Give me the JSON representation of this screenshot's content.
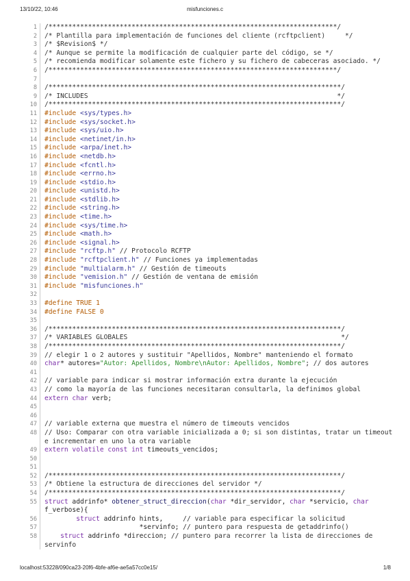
{
  "header": {
    "datetime": "13/10/22, 10:46",
    "title": "misfunciones.c"
  },
  "footer": {
    "url": "localhost:53228/090ca23-20f6-4bfe-af6e-ae5a57cc0e15/",
    "page": "1/8"
  },
  "colors": {
    "comment": "#333333",
    "preprocessor": "#b35a00",
    "include_path": "#3a3a9a",
    "keyword": "#7a2ea8",
    "string": "#2e8b2e",
    "line_number": "#888888"
  },
  "lines": [
    {
      "n": "1",
      "t": [
        [
          "comment",
          "/*************************************************************************/"
        ]
      ]
    },
    {
      "n": "2",
      "t": [
        [
          "comment",
          "/* Plantilla para implementación de funciones del cliente (rcftpclient)     */"
        ]
      ]
    },
    {
      "n": "3",
      "t": [
        [
          "comment",
          "/* $Revision$ */"
        ]
      ]
    },
    {
      "n": "4",
      "t": [
        [
          "comment",
          "/* Aunque se permite la modificación de cualquier parte del código, se */"
        ]
      ]
    },
    {
      "n": "5",
      "t": [
        [
          "comment",
          "/* recomienda modificar solamente este fichero y su fichero de cabeceras asociado. */"
        ]
      ]
    },
    {
      "n": "6",
      "t": [
        [
          "comment",
          "/*************************************************************************/"
        ]
      ]
    },
    {
      "n": "7",
      "t": []
    },
    {
      "n": "8",
      "t": [
        [
          "comment",
          "/**************************************************************************/"
        ]
      ]
    },
    {
      "n": "9",
      "t": [
        [
          "comment",
          "/* INCLUDES                                                               */"
        ]
      ]
    },
    {
      "n": "10",
      "t": [
        [
          "comment",
          "/**************************************************************************/"
        ]
      ]
    },
    {
      "n": "11",
      "t": [
        [
          "pre",
          "#include "
        ],
        [
          "inc",
          "<sys/types.h>"
        ]
      ]
    },
    {
      "n": "12",
      "t": [
        [
          "pre",
          "#include "
        ],
        [
          "inc",
          "<sys/socket.h>"
        ]
      ]
    },
    {
      "n": "13",
      "t": [
        [
          "pre",
          "#include "
        ],
        [
          "inc",
          "<sys/uio.h>"
        ]
      ]
    },
    {
      "n": "14",
      "t": [
        [
          "pre",
          "#include "
        ],
        [
          "inc",
          "<netinet/in.h>"
        ]
      ]
    },
    {
      "n": "15",
      "t": [
        [
          "pre",
          "#include "
        ],
        [
          "inc",
          "<arpa/inet.h>"
        ]
      ]
    },
    {
      "n": "16",
      "t": [
        [
          "pre",
          "#include "
        ],
        [
          "inc",
          "<netdb.h>"
        ]
      ]
    },
    {
      "n": "17",
      "t": [
        [
          "pre",
          "#include "
        ],
        [
          "inc",
          "<fcntl.h>"
        ]
      ]
    },
    {
      "n": "18",
      "t": [
        [
          "pre",
          "#include "
        ],
        [
          "inc",
          "<errno.h>"
        ]
      ]
    },
    {
      "n": "19",
      "t": [
        [
          "pre",
          "#include "
        ],
        [
          "inc",
          "<stdio.h>"
        ]
      ]
    },
    {
      "n": "20",
      "t": [
        [
          "pre",
          "#include "
        ],
        [
          "inc",
          "<unistd.h>"
        ]
      ]
    },
    {
      "n": "21",
      "t": [
        [
          "pre",
          "#include "
        ],
        [
          "inc",
          "<stdlib.h>"
        ]
      ]
    },
    {
      "n": "22",
      "t": [
        [
          "pre",
          "#include "
        ],
        [
          "inc",
          "<string.h>"
        ]
      ]
    },
    {
      "n": "23",
      "t": [
        [
          "pre",
          "#include "
        ],
        [
          "inc",
          "<time.h>"
        ]
      ]
    },
    {
      "n": "24",
      "t": [
        [
          "pre",
          "#include "
        ],
        [
          "inc",
          "<sys/time.h>"
        ]
      ]
    },
    {
      "n": "25",
      "t": [
        [
          "pre",
          "#include "
        ],
        [
          "inc",
          "<math.h>"
        ]
      ]
    },
    {
      "n": "26",
      "t": [
        [
          "pre",
          "#include "
        ],
        [
          "inc",
          "<signal.h>"
        ]
      ]
    },
    {
      "n": "27",
      "t": [
        [
          "pre",
          "#include "
        ],
        [
          "inc",
          "\"rcftp.h\""
        ],
        [
          "comment",
          " // Protocolo RCFTP"
        ]
      ]
    },
    {
      "n": "28",
      "t": [
        [
          "pre",
          "#include "
        ],
        [
          "inc",
          "\"rcftpclient.h\""
        ],
        [
          "comment",
          " // Funciones ya implementadas"
        ]
      ]
    },
    {
      "n": "29",
      "t": [
        [
          "pre",
          "#include "
        ],
        [
          "inc",
          "\"multialarm.h\""
        ],
        [
          "comment",
          " // Gestión de timeouts"
        ]
      ]
    },
    {
      "n": "30",
      "t": [
        [
          "pre",
          "#include "
        ],
        [
          "inc",
          "\"vemision.h\""
        ],
        [
          "comment",
          " // Gestión de ventana de emisión"
        ]
      ]
    },
    {
      "n": "31",
      "t": [
        [
          "pre",
          "#include "
        ],
        [
          "inc",
          "\"misfunciones.h\""
        ]
      ]
    },
    {
      "n": "32",
      "t": []
    },
    {
      "n": "33",
      "t": [
        [
          "pre",
          "#define TRUE 1"
        ]
      ]
    },
    {
      "n": "34",
      "t": [
        [
          "pre",
          "#define FALSE 0"
        ]
      ]
    },
    {
      "n": "35",
      "t": []
    },
    {
      "n": "36",
      "t": [
        [
          "comment",
          "/**************************************************************************/"
        ]
      ]
    },
    {
      "n": "37",
      "t": [
        [
          "comment",
          "/* VARIABLES GLOBALES                                                      */"
        ]
      ]
    },
    {
      "n": "38",
      "t": [
        [
          "comment",
          "/**************************************************************************/"
        ]
      ]
    },
    {
      "n": "39",
      "t": [
        [
          "comment",
          "// elegir 1 o 2 autores y sustituir \"Apellidos, Nombre\" manteniendo el formato"
        ]
      ]
    },
    {
      "n": "40",
      "t": [
        [
          "kw",
          "char"
        ],
        [
          "plain",
          "* autores="
        ],
        [
          "str",
          "\"Autor: Apellidos, Nombre\\nAutor: Apellidos, Nombre\""
        ],
        [
          "plain",
          "; "
        ],
        [
          "comment",
          "// dos autores"
        ]
      ]
    },
    {
      "n": "41",
      "t": []
    },
    {
      "n": "42",
      "t": [
        [
          "comment",
          "// variable para indicar si mostrar información extra durante la ejecución"
        ]
      ]
    },
    {
      "n": "43",
      "t": [
        [
          "comment",
          "// como la mayoría de las funciones necesitaran consultarla, la definimos global"
        ]
      ]
    },
    {
      "n": "44",
      "t": [
        [
          "kw",
          "extern char"
        ],
        [
          "plain",
          " verb;"
        ]
      ]
    },
    {
      "n": "45",
      "t": []
    },
    {
      "n": "46",
      "t": []
    },
    {
      "n": "47",
      "t": [
        [
          "comment",
          "// variable externa que muestra el número de timeouts vencidos"
        ]
      ]
    },
    {
      "n": "48",
      "t": [
        [
          "comment",
          "// Uso: Comparar con otra variable inicializada a 0; si son distintas, tratar un timeout e incrementar en uno la otra variable"
        ]
      ]
    },
    {
      "n": "49",
      "t": [
        [
          "kw",
          "extern volatile const int"
        ],
        [
          "plain",
          " timeouts_vencidos;"
        ]
      ]
    },
    {
      "n": "50",
      "t": []
    },
    {
      "n": "51",
      "t": []
    },
    {
      "n": "52",
      "t": [
        [
          "comment",
          "/**************************************************************************/"
        ]
      ]
    },
    {
      "n": "53",
      "t": [
        [
          "comment",
          "/* Obtiene la estructura de direcciones del servidor */"
        ]
      ]
    },
    {
      "n": "54",
      "t": [
        [
          "comment",
          "/**************************************************************************/"
        ]
      ]
    },
    {
      "n": "55",
      "t": [
        [
          "kw",
          "struct"
        ],
        [
          "plain",
          " addrinfo* "
        ],
        [
          "fn",
          "obtener_struct_direccion"
        ],
        [
          "plain",
          "("
        ],
        [
          "kw",
          "char"
        ],
        [
          "plain",
          " *dir_servidor, "
        ],
        [
          "kw",
          "char"
        ],
        [
          "plain",
          " *servicio, "
        ],
        [
          "kw",
          "char"
        ],
        [
          "plain",
          " f_verbose){"
        ]
      ]
    },
    {
      "n": "56",
      "t": [
        [
          "plain",
          "        "
        ],
        [
          "kw",
          "struct"
        ],
        [
          "plain",
          " addrinfo hints,     "
        ],
        [
          "comment",
          "// variable para especificar la solicitud"
        ]
      ]
    },
    {
      "n": "57",
      "t": [
        [
          "plain",
          "                        *servinfo; "
        ],
        [
          "comment",
          "// puntero para respuesta de getaddrinfo()"
        ]
      ]
    },
    {
      "n": "58",
      "t": [
        [
          "plain",
          "    "
        ],
        [
          "kw",
          "struct"
        ],
        [
          "plain",
          " addrinfo *direccion; "
        ],
        [
          "comment",
          "// puntero para recorrer la lista de direcciones de servinfo"
        ]
      ]
    }
  ]
}
